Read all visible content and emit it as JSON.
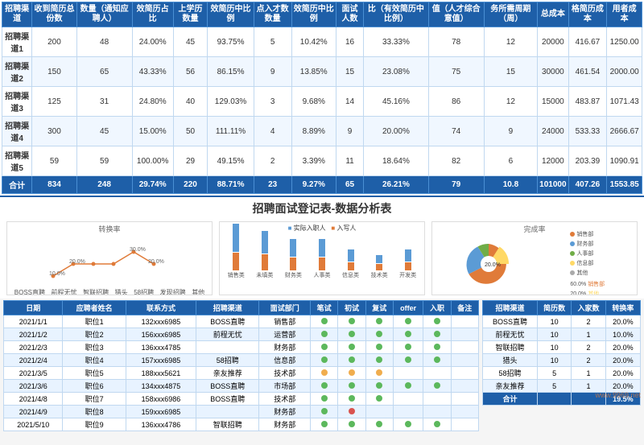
{
  "topTable": {
    "headers": [
      "招聘渠道",
      "收到简历总份数",
      "数量（通知应聘人）",
      "效简历占比",
      "上学历数量",
      "效简历中比例",
      "点入才数数量",
      "效简历中比例",
      "面试人数",
      "比（有效简历中比例）",
      "值（人才综合意值）",
      "务所需周期（周）",
      "总成本",
      "格简历成本",
      "用者成本"
    ],
    "rows": [
      {
        "channel": "招聘渠道1",
        "values": [
          "200",
          "48",
          "24.00%",
          "45",
          "93.75%",
          "5",
          "10.42%",
          "16",
          "33.33%",
          "78",
          "12",
          "20000",
          "416.67",
          "1250.00"
        ]
      },
      {
        "channel": "招聘渠道2",
        "values": [
          "150",
          "65",
          "43.33%",
          "56",
          "86.15%",
          "9",
          "13.85%",
          "15",
          "23.08%",
          "75",
          "15",
          "30000",
          "461.54",
          "2000.00"
        ]
      },
      {
        "channel": "招聘渠道3",
        "values": [
          "125",
          "31",
          "24.80%",
          "40",
          "129.03%",
          "3",
          "9.68%",
          "14",
          "45.16%",
          "86",
          "12",
          "15000",
          "483.87",
          "1071.43"
        ]
      },
      {
        "channel": "招聘渠道4",
        "values": [
          "300",
          "45",
          "15.00%",
          "50",
          "111.11%",
          "4",
          "8.89%",
          "9",
          "20.00%",
          "74",
          "9",
          "24000",
          "533.33",
          "2666.67"
        ]
      },
      {
        "channel": "招聘渠道5",
        "values": [
          "59",
          "59",
          "100.00%",
          "29",
          "49.15%",
          "2",
          "3.39%",
          "11",
          "18.64%",
          "82",
          "6",
          "12000",
          "203.39",
          "1090.91"
        ]
      },
      {
        "channel": "合计",
        "values": [
          "834",
          "248",
          "29.74%",
          "220",
          "88.71%",
          "23",
          "9.27%",
          "65",
          "26.21%",
          "79",
          "10.8",
          "101000",
          "407.26",
          "1553.85"
        ],
        "isTotal": true
      }
    ]
  },
  "bottomTitle": "招聘面试登记表-数据分析表",
  "lineChart": {
    "title": "转换率",
    "points": [
      10,
      20,
      20,
      20,
      30,
      20
    ],
    "labels": [
      "BOSS直聘",
      "前程无忧",
      "智联招聘",
      "猎头",
      "58招聘",
      "发现招聘",
      "其他"
    ]
  },
  "barChart": {
    "title": "",
    "legend": [
      "实际入职人",
      "入写人"
    ],
    "categories": [
      "销售类",
      "未填类",
      "财务类",
      "人事类",
      "信息类",
      "技术类",
      "开发类"
    ],
    "seriesA": [
      5,
      4,
      3,
      3,
      2,
      1,
      2
    ],
    "seriesB": [
      3,
      3,
      2,
      2,
      1,
      1,
      1
    ]
  },
  "pieChart": {
    "title": "完成率",
    "slices": [
      {
        "label": "销售部",
        "pct": 60,
        "color": "#e07b39"
      },
      {
        "label": "财务部",
        "pct": 10,
        "color": "#5b9bd5"
      },
      {
        "label": "人事部",
        "pct": 10,
        "color": "#70ad47"
      },
      {
        "label": "信息部",
        "pct": 20,
        "color": "#ffd966"
      }
    ]
  },
  "interviewTable": {
    "headers": [
      "日期",
      "应聘者姓名",
      "联系方式",
      "招聘渠道",
      "面试部门",
      "笔试",
      "初试",
      "复试",
      "offer",
      "入职",
      "备注"
    ],
    "rows": [
      [
        "2021/1/1",
        "职位1",
        "132xxx6985",
        "BOSS直聘",
        "销售部",
        "green",
        "green",
        "green",
        "green",
        "green",
        ""
      ],
      [
        "2021/1/2",
        "职位2",
        "156xxx6985",
        "前程无忧",
        "运营部",
        "green",
        "green",
        "green",
        "green",
        "green",
        ""
      ],
      [
        "2021/2/3",
        "职位3",
        "136xxx4785",
        "",
        "财务部",
        "green",
        "green",
        "green",
        "green",
        "green",
        ""
      ],
      [
        "2021/2/4",
        "职位4",
        "157xxx6985",
        "58招聘",
        "信息部",
        "green",
        "green",
        "green",
        "green",
        "green",
        ""
      ],
      [
        "2021/3/5",
        "职位5",
        "188xxx5621",
        "亲友推荐",
        "技术部",
        "orange",
        "orange",
        "orange",
        "",
        "",
        ""
      ],
      [
        "2021/3/6",
        "职位6",
        "134xxx4875",
        "BOSS直聘",
        "市场部",
        "green",
        "green",
        "green",
        "green",
        "green",
        ""
      ],
      [
        "2021/4/8",
        "职位7",
        "158xxx6986",
        "BOSS直聘",
        "技术部",
        "green",
        "green",
        "green",
        "",
        "",
        ""
      ],
      [
        "2021/4/9",
        "职位8",
        "159xxx6985",
        "",
        "财务部",
        "green",
        "red",
        "",
        "",
        "",
        ""
      ],
      [
        "2021/5/10",
        "职位9",
        "136xxx4786",
        "智联招聘",
        "财务部",
        "green",
        "green",
        "green",
        "green",
        "green",
        ""
      ]
    ]
  },
  "sideTable": {
    "headers": [
      "招聘渠道",
      "简历数",
      "入家数",
      "转换率"
    ],
    "rows": [
      [
        "BOSS直聘",
        "10",
        "2",
        "20.0%"
      ],
      [
        "前程无忧",
        "10",
        "1",
        "10.0%"
      ],
      [
        "智联招聘",
        "10",
        "2",
        "20.0%"
      ],
      [
        "猎头",
        "10",
        "2",
        "20.0%"
      ],
      [
        "58招聘",
        "5",
        "1",
        "20.0%"
      ],
      [
        "亲友推荐",
        "5",
        "1",
        "20.0%"
      ]
    ],
    "total": [
      "合计",
      "",
      "",
      "19.5%"
    ]
  },
  "watermark": "www.9969.net"
}
